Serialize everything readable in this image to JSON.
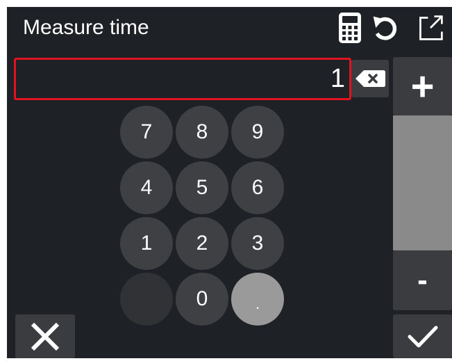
{
  "header": {
    "title": "Measure time",
    "icons": [
      "calculator-icon",
      "reset-icon",
      "popout-icon"
    ]
  },
  "input": {
    "value": "1"
  },
  "keypad": {
    "keys": [
      "7",
      "8",
      "9",
      "4",
      "5",
      "6",
      "1",
      "2",
      "3",
      "",
      "0",
      "."
    ]
  },
  "side_controls": {
    "plus_label": "+",
    "minus_label": "-"
  },
  "colors": {
    "background": "#1e2126",
    "key": "#3e4044",
    "field_border": "#e0131f",
    "slider_track": "#8a8a8a"
  }
}
